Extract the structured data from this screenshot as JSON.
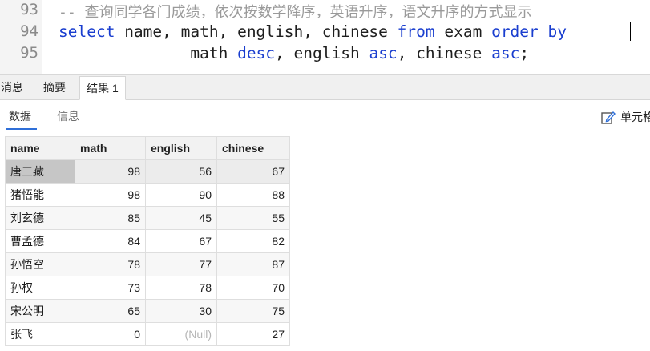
{
  "editor": {
    "line_numbers": [
      "93",
      "94",
      "95"
    ],
    "comment": "-- 查询同学各门成绩，依次按数学降序，英语升序，语文升序的方式显示",
    "line94": {
      "select_kw": "select",
      "cols": " name, math, english, chinese ",
      "from_kw": "from",
      "table": " exam ",
      "order_kw": "order",
      "sp": " ",
      "by_kw": "by"
    },
    "line95": {
      "indent": "              ",
      "col1": "math ",
      "desc_kw": "desc",
      "col2": ", english ",
      "asc_kw1": "asc",
      "col3": ", chinese ",
      "asc_kw2": "asc",
      "end": ";"
    }
  },
  "result_tabs": [
    "消息",
    "摘要",
    "结果 1"
  ],
  "sub_tabs": [
    "数据",
    "信息"
  ],
  "cell_button_label": "单元格",
  "grid": {
    "columns": [
      "name",
      "math",
      "english",
      "chinese"
    ],
    "rows": [
      {
        "name": "唐三藏",
        "math": "98",
        "english": "56",
        "chinese": "67"
      },
      {
        "name": "猪悟能",
        "math": "98",
        "english": "90",
        "chinese": "88"
      },
      {
        "name": "刘玄德",
        "math": "85",
        "english": "45",
        "chinese": "55"
      },
      {
        "name": "曹孟德",
        "math": "84",
        "english": "67",
        "chinese": "82"
      },
      {
        "name": "孙悟空",
        "math": "78",
        "english": "77",
        "chinese": "87"
      },
      {
        "name": "孙权",
        "math": "73",
        "english": "78",
        "chinese": "70"
      },
      {
        "name": "宋公明",
        "math": "65",
        "english": "30",
        "chinese": "75"
      },
      {
        "name": "张飞",
        "math": "0",
        "english": "(Null)",
        "chinese": "27"
      }
    ]
  },
  "colors": {
    "keyword": "#1a3ecf",
    "comment": "#9a9a9a",
    "accent": "#2f6fd8",
    "selected_cell": "#c6c6c6"
  }
}
